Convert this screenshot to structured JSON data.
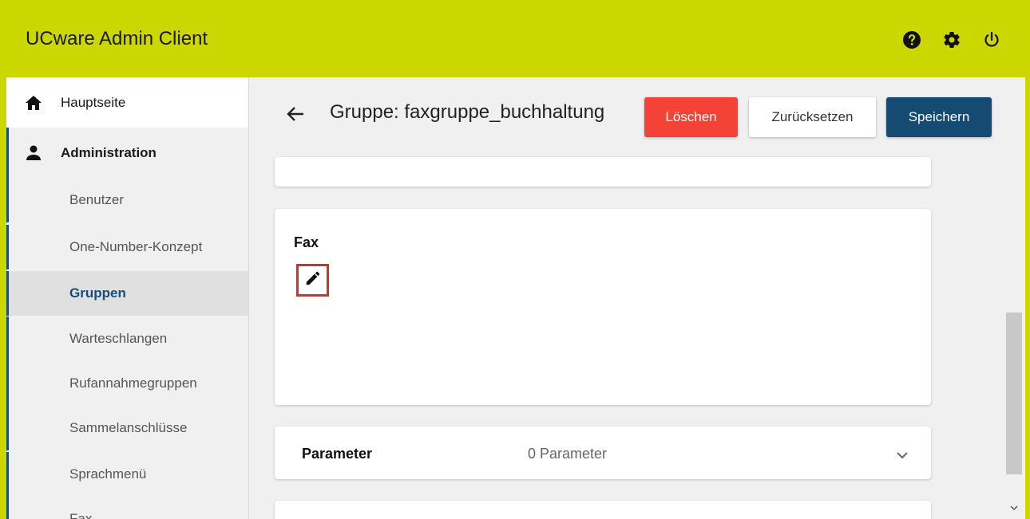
{
  "app": {
    "title": "UCware Admin Client"
  },
  "header_icons": [
    "help-icon",
    "gear-icon",
    "power-icon"
  ],
  "sidebar": {
    "home": "Hauptseite",
    "admin": "Administration",
    "items": [
      "Benutzer",
      "One-Number-Konzept",
      "Gruppen",
      "Warteschlangen",
      "Rufannahmegruppen",
      "Sammelanschlüsse",
      "Sprachmenü",
      "Fax"
    ],
    "active": "Gruppen"
  },
  "page": {
    "title": "Gruppe: faxgruppe_buchhaltung",
    "buttons": {
      "delete": "Löschen",
      "reset": "Zurücksetzen",
      "save": "Speichern"
    }
  },
  "fax_card": {
    "title": "Fax"
  },
  "param_card": {
    "label": "Parameter",
    "value": "0 Parameter"
  },
  "colors": {
    "accent": "#ccd600",
    "primary": "#154a72",
    "danger": "#f44336",
    "highlight": "#d32f2f"
  }
}
